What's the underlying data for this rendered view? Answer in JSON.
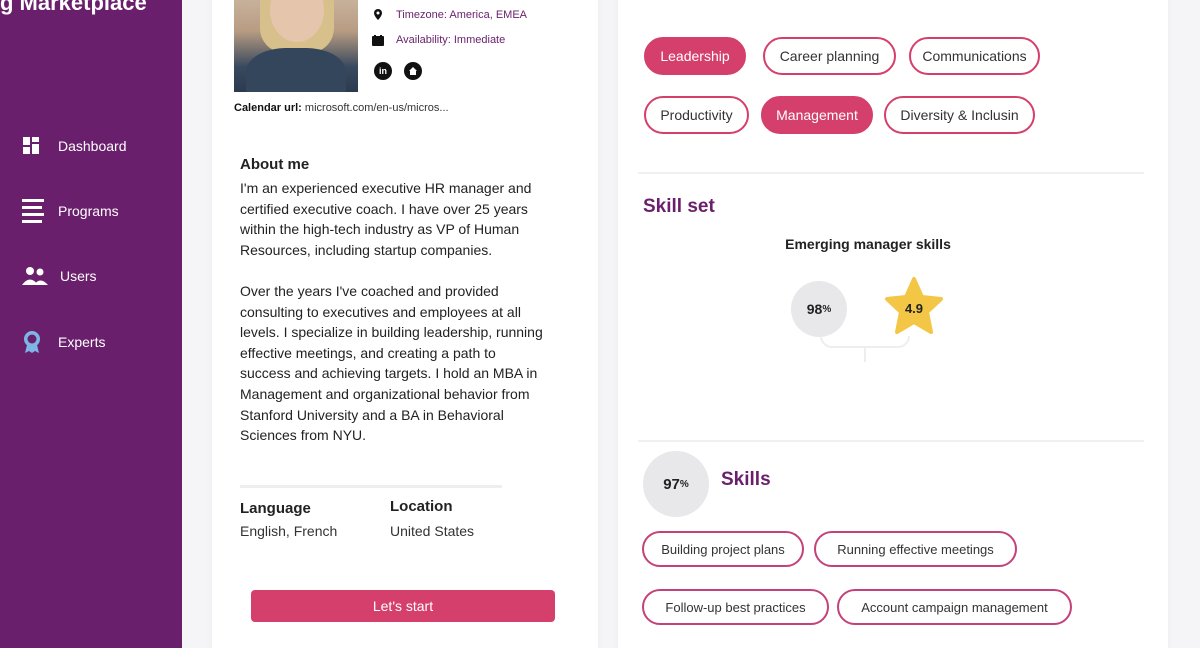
{
  "brand": {
    "title": "g Marketplace"
  },
  "sidebar": {
    "items": [
      {
        "label": "Dashboard",
        "icon": "dashboard-icon"
      },
      {
        "label": "Programs",
        "icon": "list-icon"
      },
      {
        "label": "Users",
        "icon": "users-icon"
      },
      {
        "label": "Experts",
        "icon": "award-icon"
      }
    ]
  },
  "profile": {
    "timezone": "Timezone: America, EMEA",
    "availability": "Availability: Immediate",
    "social": {
      "linkedin": "in",
      "home_icon": "home-icon"
    },
    "calendar_label": "Calendar url:",
    "calendar_value": "microsoft.com/en-us/micros...",
    "about_title": "About me",
    "about_text": "I'm an experienced executive HR manager and\ncertified executive coach. I have over 25 years\nwithin the high-tech industry as VP of Human\nResources, including startup companies.\n\nOver the years I've coached and provided\nconsulting to executives and employees at all\nlevels. I specialize in building leadership, running\neffective meetings, and creating a path to\nsuccess and achieving targets. I hold an MBA in\nManagement and organizational behavior from\nStanford University and a BA in Behavioral\nSciences from NYU.",
    "language_label": "Language",
    "language_value": "English, French",
    "location_label": "Location",
    "location_value": "United States",
    "start_button": "Let's start"
  },
  "topics": [
    {
      "label": "Leadership",
      "selected": true
    },
    {
      "label": "Career planning",
      "selected": false
    },
    {
      "label": "Communications",
      "selected": false
    },
    {
      "label": "Productivity",
      "selected": false
    },
    {
      "label": "Management",
      "selected": true
    },
    {
      "label": "Diversity & Inclusin",
      "selected": false
    }
  ],
  "skillset": {
    "title": "Skill set",
    "subtitle": "Emerging manager skills",
    "percent": "98",
    "percent_unit": "%",
    "rating": "4.9"
  },
  "skills": {
    "title": "Skills",
    "percent": "97",
    "percent_unit": "%",
    "items": [
      "Building project plans",
      "Running effective meetings",
      "Follow-up best practices",
      "Account campaign management"
    ]
  },
  "colors": {
    "sidebar": "#6a1f6c",
    "accent": "#d43f6c",
    "star": "#f3c646"
  }
}
